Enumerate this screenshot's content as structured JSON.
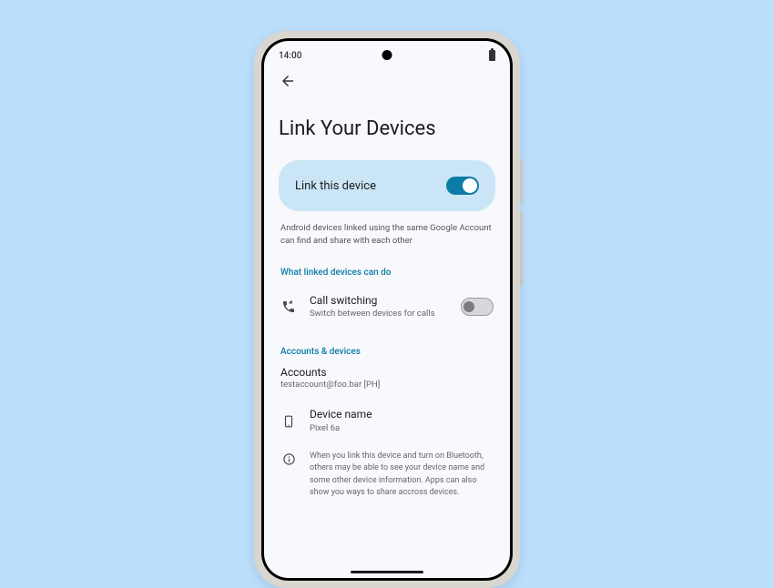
{
  "statusBar": {
    "time": "14:00"
  },
  "page": {
    "title": "Link Your Devices"
  },
  "primaryToggle": {
    "label": "Link this device",
    "enabled": true
  },
  "description": "Android devices linked using the same Google Account can find and share with each other",
  "sections": {
    "linkedDevicesHeader": "What linked devices can do",
    "accountsDevicesHeader": "Accounts & devices"
  },
  "callSwitching": {
    "title": "Call switching",
    "subtitle": "Switch between devices for calls",
    "enabled": false
  },
  "accounts": {
    "title": "Accounts",
    "value": "testaccount@foo.bar [PH]"
  },
  "deviceName": {
    "title": "Device name",
    "value": "Pixel 6a"
  },
  "infoText": "When you link this device and turn on Bluetooth, others may be able to see your device name and some other device information. Apps can also show you ways to share accross devices.",
  "colors": {
    "background": "#bbdefb",
    "screen": "#f7f9fc",
    "primaryCard": "#cae6f6",
    "accent": "#0b7ba8"
  }
}
